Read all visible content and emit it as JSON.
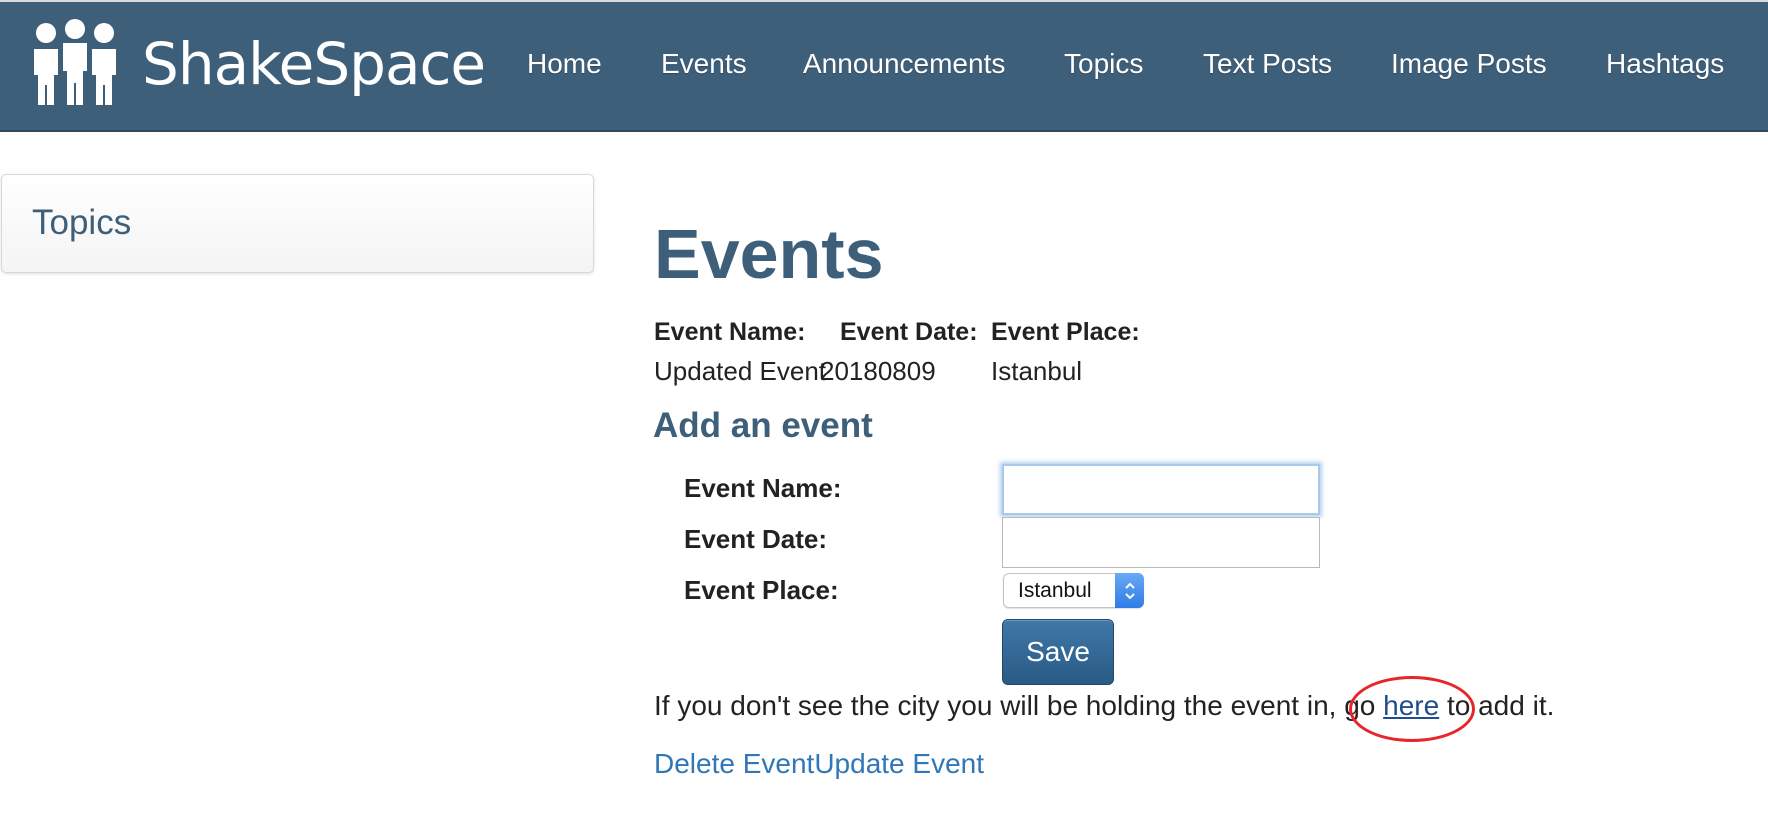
{
  "brand": {
    "name": "ShakeSpace"
  },
  "nav": {
    "items": [
      {
        "label": "Home"
      },
      {
        "label": "Events"
      },
      {
        "label": "Announcements"
      },
      {
        "label": "Topics"
      },
      {
        "label": "Text Posts"
      },
      {
        "label": "Image Posts"
      },
      {
        "label": "Hashtags"
      }
    ]
  },
  "sidebar": {
    "title": "Topics"
  },
  "main": {
    "title": "Events",
    "table": {
      "headers": [
        "Event Name:",
        "Event Date:",
        "Event Place:"
      ],
      "rows": [
        [
          "Updated Event",
          "20180809",
          "Istanbul"
        ]
      ]
    },
    "form": {
      "title": "Add an event",
      "name_label": "Event Name:",
      "name_value": "",
      "date_label": "Event Date:",
      "date_value": "",
      "place_label": "Event Place:",
      "place_selected": "Istanbul",
      "save_label": "Save"
    },
    "hint": {
      "before": "If you don't see the city you will be holding the event in, go ",
      "link": "here",
      "after": " to add it."
    },
    "actions": {
      "delete_label": "Delete Event",
      "update_label": "Update Event"
    }
  },
  "colors": {
    "navbar": "#3e5f7a",
    "heading": "#3e5f7a",
    "button": "#2a5a85",
    "link": "#2f77b8",
    "annotation": "#e8262a"
  }
}
